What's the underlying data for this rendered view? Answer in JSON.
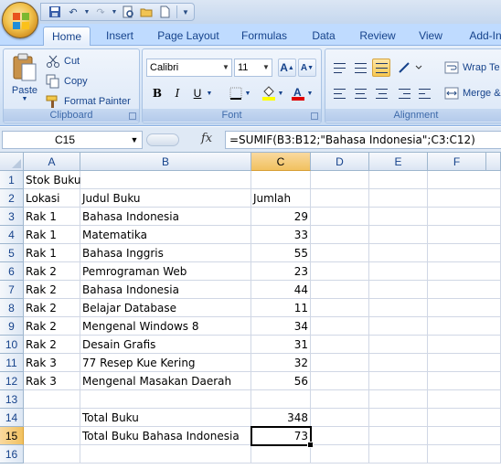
{
  "ribbon": {
    "tabs": [
      "Home",
      "Insert",
      "Page Layout",
      "Formulas",
      "Data",
      "Review",
      "View",
      "Add-In"
    ],
    "active_tab": "Home",
    "clipboard": {
      "paste": "Paste",
      "cut": "Cut",
      "copy": "Copy",
      "format_painter": "Format Painter",
      "label": "Clipboard"
    },
    "font": {
      "name": "Calibri",
      "size": "11",
      "label": "Font",
      "bold": "B",
      "italic": "I",
      "underline": "U"
    },
    "alignment": {
      "wrap_text": "Wrap Te",
      "merge": "Merge &",
      "label": "Alignment"
    }
  },
  "formula_bar": {
    "name_box": "C15",
    "fx": "fx",
    "formula": "=SUMIF(B3:B12;\"Bahasa Indonesia\";C3:C12)"
  },
  "sheet": {
    "columns": [
      "A",
      "B",
      "C",
      "D",
      "E",
      "F"
    ],
    "active_column": "C",
    "active_row": "15",
    "rows": [
      {
        "num": "1",
        "A": "Stok Buku",
        "B": "",
        "C": ""
      },
      {
        "num": "2",
        "A": "Lokasi",
        "B": "Judul Buku",
        "C": "Jumlah"
      },
      {
        "num": "3",
        "A": "Rak 1",
        "B": "Bahasa Indonesia",
        "C": "29"
      },
      {
        "num": "4",
        "A": "Rak 1",
        "B": "Matematika",
        "C": "33"
      },
      {
        "num": "5",
        "A": "Rak 1",
        "B": "Bahasa Inggris",
        "C": "55"
      },
      {
        "num": "6",
        "A": "Rak 2",
        "B": "Pemrograman Web",
        "C": "23"
      },
      {
        "num": "7",
        "A": "Rak 2",
        "B": "Bahasa Indonesia",
        "C": "44"
      },
      {
        "num": "8",
        "A": "Rak 2",
        "B": "Belajar Database",
        "C": "11"
      },
      {
        "num": "9",
        "A": "Rak 2",
        "B": "Mengenal Windows 8",
        "C": "34"
      },
      {
        "num": "10",
        "A": "Rak 2",
        "B": "Desain Grafis",
        "C": "31"
      },
      {
        "num": "11",
        "A": "Rak 3",
        "B": "77 Resep Kue Kering",
        "C": "32"
      },
      {
        "num": "12",
        "A": "Rak 3",
        "B": "Mengenal Masakan Daerah",
        "C": "56"
      },
      {
        "num": "13",
        "A": "",
        "B": "",
        "C": ""
      },
      {
        "num": "14",
        "A": "",
        "B": "Total Buku",
        "C": "348"
      },
      {
        "num": "15",
        "A": "",
        "B": "Total Buku Bahasa Indonesia",
        "C": "73"
      },
      {
        "num": "16",
        "A": "",
        "B": "",
        "C": ""
      }
    ]
  }
}
